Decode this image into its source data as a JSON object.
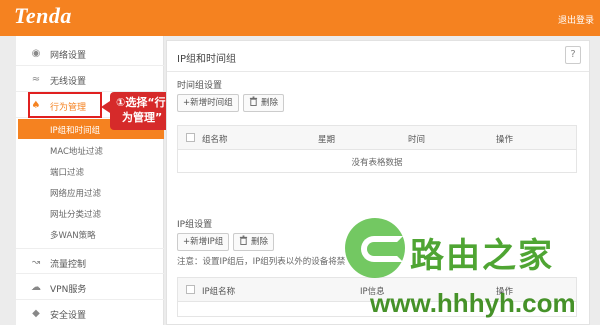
{
  "header": {
    "logo_text": "Tenda",
    "logout_label": "退出登录",
    "brand_color": "#f58220"
  },
  "sidebar": {
    "items": [
      {
        "label": "网络设置",
        "icon": "globe-icon"
      },
      {
        "label": "无线设置",
        "icon": "wifi-icon"
      },
      {
        "label": "行为管理",
        "icon": "user-manage-icon"
      },
      {
        "label": "流量控制",
        "icon": "traffic-icon"
      },
      {
        "label": "VPN服务",
        "icon": "vpn-icon"
      },
      {
        "label": "安全设置",
        "icon": "shield-icon"
      }
    ],
    "subitems": [
      {
        "label": "IP组和时间组"
      },
      {
        "label": "MAC地址过滤"
      },
      {
        "label": "端口过滤"
      },
      {
        "label": "网络应用过滤"
      },
      {
        "label": "网址分类过滤"
      },
      {
        "label": "多WAN策略"
      }
    ]
  },
  "annotation": {
    "line1": "①选择“行",
    "line2": "为管理”",
    "color": "#d62a2a"
  },
  "main": {
    "title": "IP组和时间组",
    "help_label": "?",
    "time_group": {
      "section_label": "时间组设置",
      "add_label": "+新增时间组",
      "delete_label": "删除",
      "columns": [
        "组名称",
        "星期",
        "时间",
        "操作"
      ],
      "empty_text": "没有表格数据"
    },
    "ip_group": {
      "section_label": "IP组设置",
      "add_label": "+新增IP组",
      "delete_label": "删除",
      "notice": "注意：设置IP组后，IP组列表以外的设备将禁",
      "columns": [
        "IP组名称",
        "IP信息",
        "操作"
      ]
    }
  },
  "watermark": {
    "text": "路由之家",
    "url": "www.hhhyh.com"
  }
}
